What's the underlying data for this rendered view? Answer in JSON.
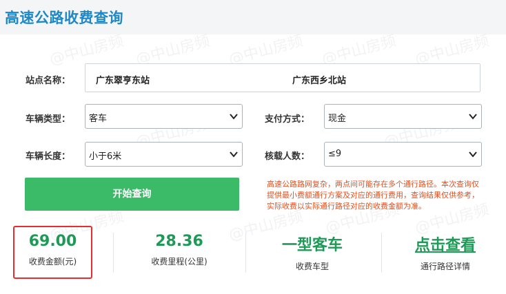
{
  "title": "高速公路收费查询",
  "form": {
    "station_label": "站点名称：",
    "from_station": "广东翠亨东站",
    "to_station": "广东西乡北站",
    "vehicle_type_label": "车辆类型：",
    "vehicle_type_value": "客车",
    "payment_label": "支付方式：",
    "payment_value": "现金",
    "vehicle_length_label": "车辆长度：",
    "vehicle_length_value": "小于6米",
    "passengers_label": "核载人数：",
    "passengers_value": "≤9",
    "query_button": "开始查询",
    "notice": "高速公路路网复杂，两点间可能存在多个通行路径。本次查询仅提供最小费额通行方案及对应的通行费用，查询结果仅供参考，实际收费以实际通行路径对应的收费金额为准。"
  },
  "results": {
    "fee_value": "69.00",
    "fee_label": "收费金额(元)",
    "distance_value": "28.36",
    "distance_label": "收费里程(公里)",
    "vehicle_model_value": "一型客车",
    "vehicle_model_label": "收费车型",
    "details_link": "点击查看",
    "details_label": "通行路径详情"
  },
  "watermark": "@中山房频",
  "colors": {
    "title": "#1e88c7",
    "button": "#3bba67",
    "result_value": "#1e9a57",
    "notice": "#e4501e",
    "highlight_box": "#e52d2d"
  }
}
